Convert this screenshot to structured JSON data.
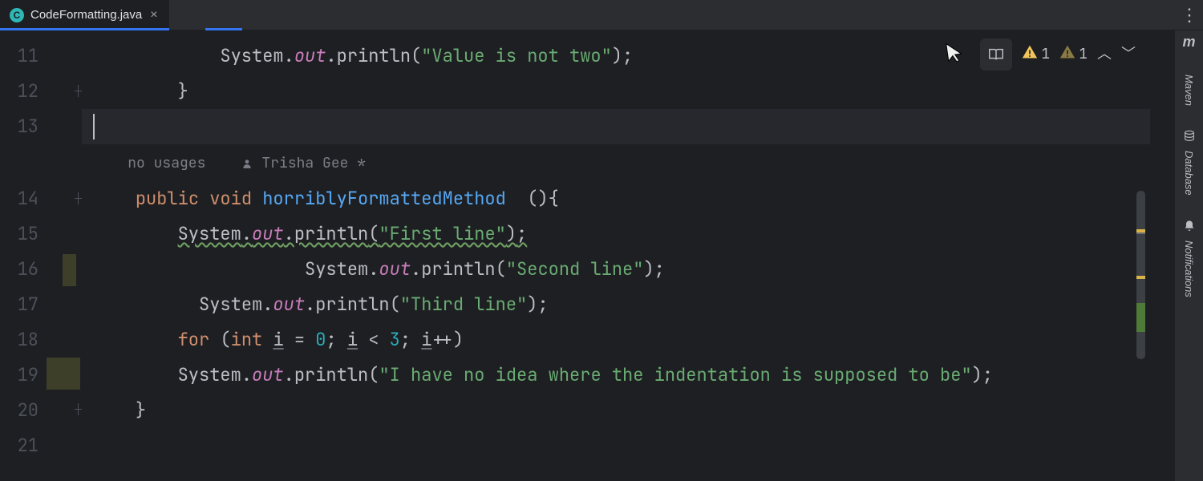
{
  "tab": {
    "filename": "CodeFormatting.java",
    "file_icon_letter": "C"
  },
  "line_numbers": [
    "11",
    "12",
    "13",
    "14",
    "15",
    "16",
    "17",
    "18",
    "19",
    "20",
    "21"
  ],
  "inlay": {
    "usages": "no usages",
    "author": "Trisha Gee *"
  },
  "code": {
    "l11": {
      "indent": "            ",
      "sys": "System",
      "dot1": ".",
      "out": "out",
      "dot2": ".",
      "println": "println",
      "paren_open": "(",
      "str": "\"Value is not two\"",
      "paren_close": ");"
    },
    "l12": {
      "indent": "        ",
      "brace": "}"
    },
    "l14": {
      "indent": "    ",
      "kw_public": "public",
      "sp1": " ",
      "kw_void": "void",
      "sp2": " ",
      "name": "horriblyFormattedMethod",
      "spaces": "  ",
      "sig": "(){"
    },
    "l15": {
      "indent": "        ",
      "sys": "System",
      "dot1": ".",
      "out": "out",
      "dot2": ".",
      "println": "println",
      "paren_open": "(",
      "str": "\"First line\"",
      "paren_close": ")",
      "semi": ";"
    },
    "l16": {
      "indent": "                    ",
      "sys": "System",
      "dot1": ".",
      "out": "out",
      "dot2": ".",
      "println": "println",
      "paren_open": "(",
      "str": "\"Second line\"",
      "paren_close": ");"
    },
    "l17": {
      "indent": "          ",
      "sys": "System",
      "dot1": ".",
      "out": "out",
      "dot2": ".",
      "println": "println",
      "paren_open": "(",
      "str": "\"Third line\"",
      "paren_close": ");"
    },
    "l18": {
      "indent": "        ",
      "kw_for": "for",
      "sp1": " ",
      "op_open": "(",
      "kw_int": "int",
      "sp2": " ",
      "var_i1": "i",
      "eq": " = ",
      "zero": "0",
      "semi1": "; ",
      "var_i2": "i",
      "lt": " < ",
      "three": "3",
      "semi2": "; ",
      "var_i3": "i",
      "inc": "++",
      "op_close": ")"
    },
    "l19": {
      "indent": "        ",
      "sys": "System",
      "dot1": ".",
      "out": "out",
      "dot2": ".",
      "println": "println",
      "paren_open": "(",
      "str": "\"I have no idea where the indentation is supposed to be\"",
      "paren_close": ");"
    },
    "l20": {
      "indent": "    ",
      "brace": "}"
    }
  },
  "problems": {
    "warn1_count": "1",
    "warn2_count": "1"
  },
  "sidebar": {
    "maven": "Maven",
    "database": "Database",
    "notifications": "Notifications",
    "m_logo": "m"
  }
}
